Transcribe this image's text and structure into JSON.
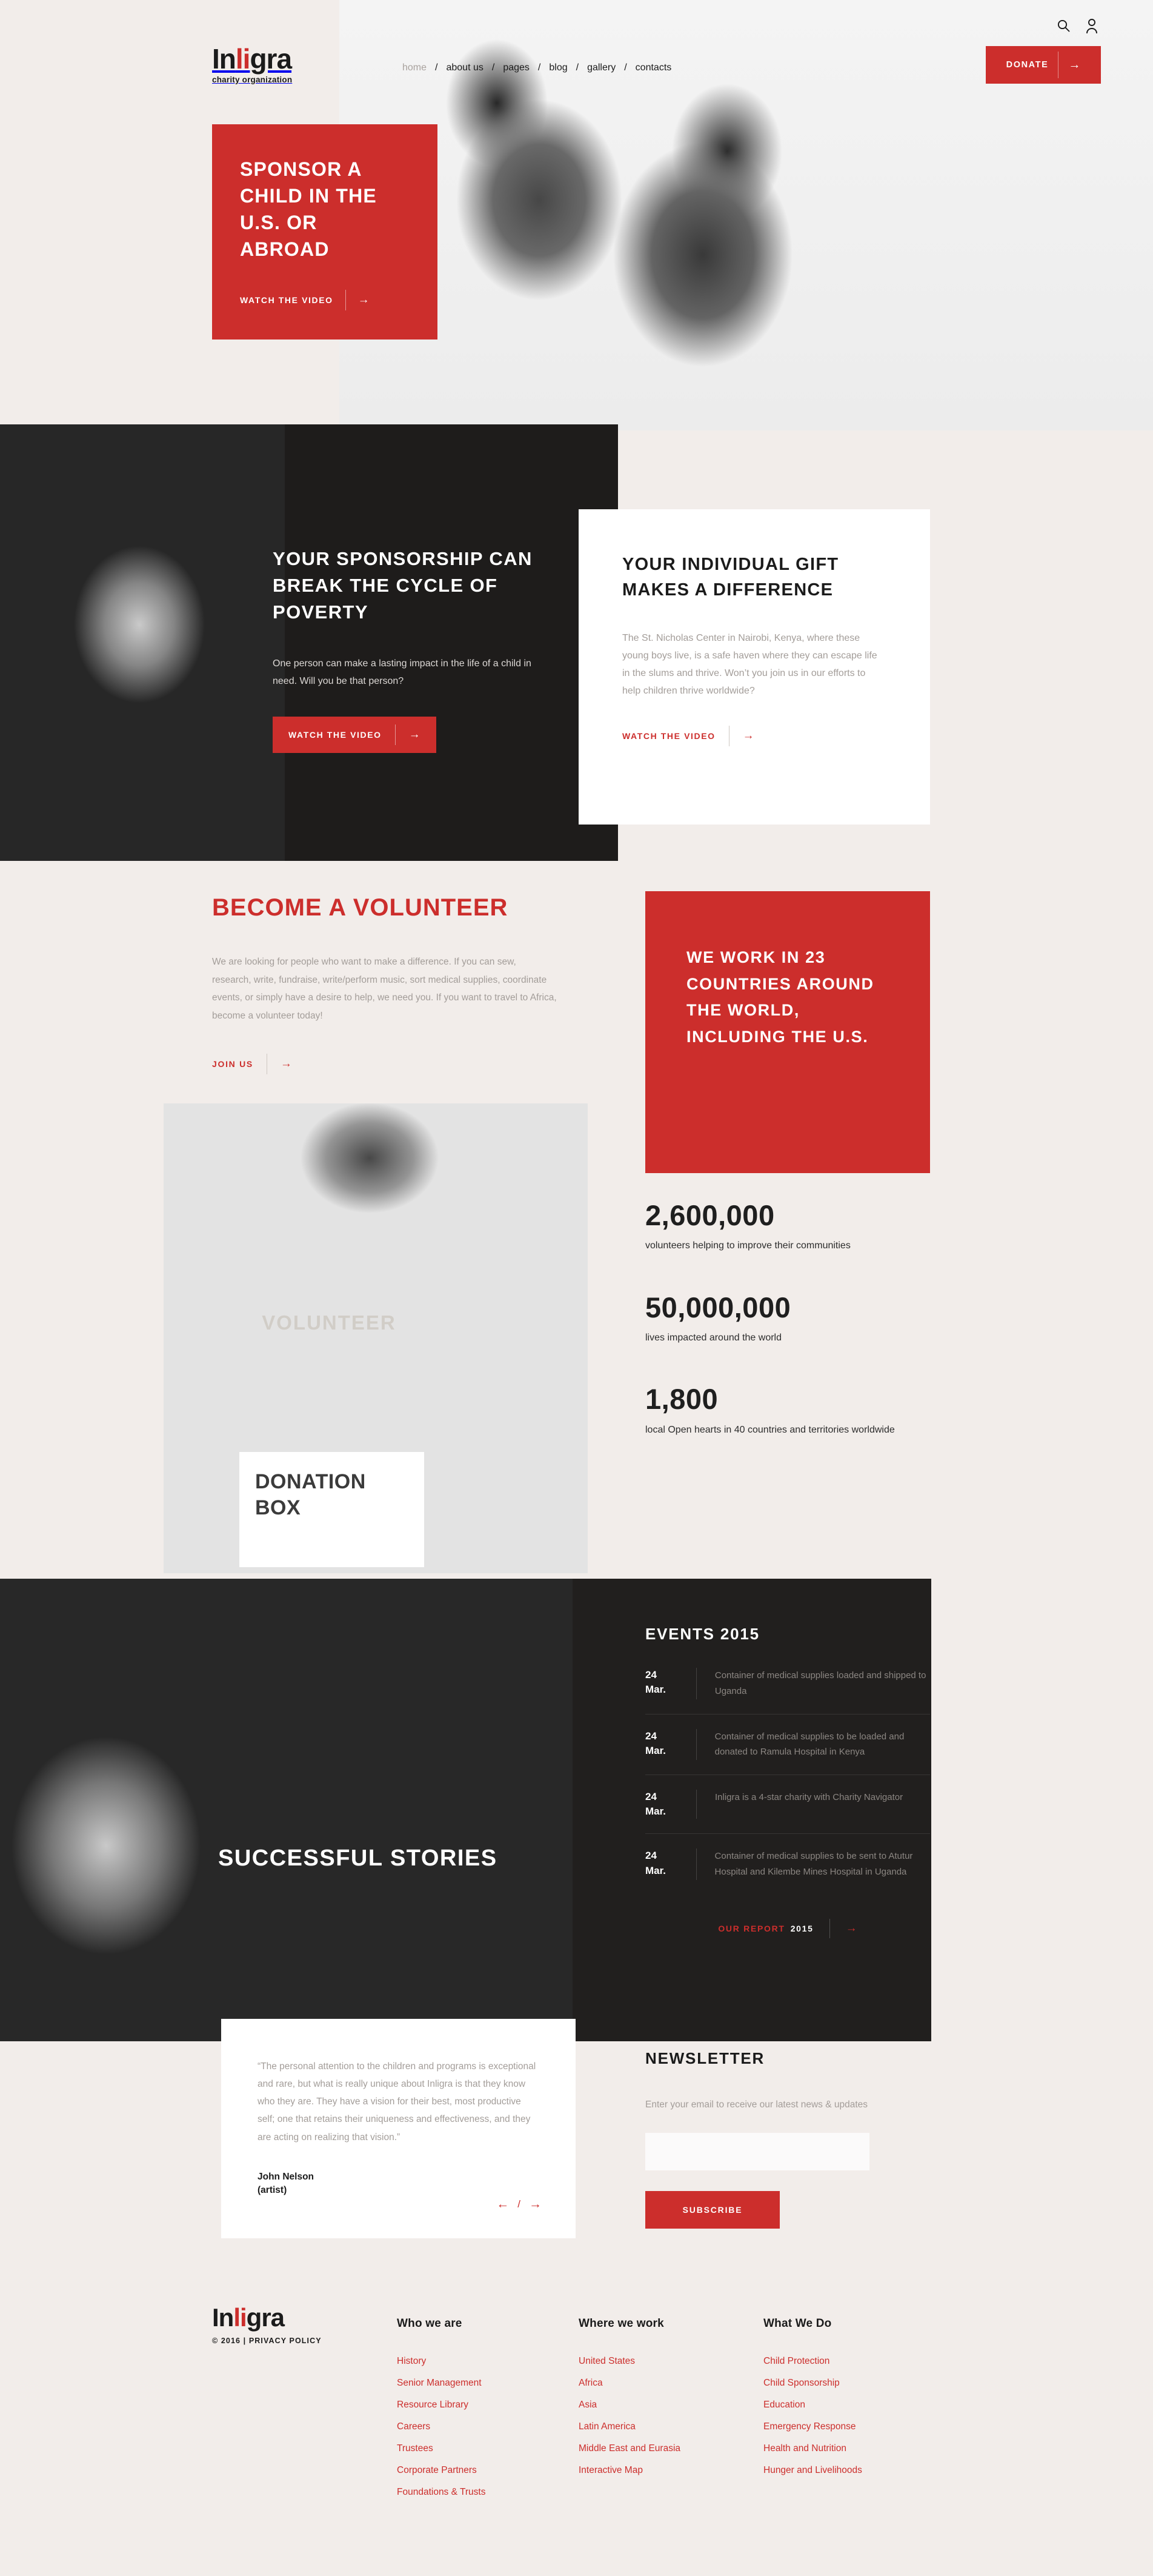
{
  "brand": {
    "name_part1": "In",
    "name_li": "li",
    "name_part2": "gra",
    "tagline": "charity organization"
  },
  "header": {
    "nav": [
      {
        "label": "home",
        "active": true
      },
      {
        "label": "about us",
        "active": false
      },
      {
        "label": "pages",
        "active": false
      },
      {
        "label": "blog",
        "active": false
      },
      {
        "label": "gallery",
        "active": false
      },
      {
        "label": "contacts",
        "active": false
      }
    ],
    "separator": "/",
    "donate_label": "DONATE",
    "arrow": "→",
    "search_icon": "search-icon",
    "account_icon": "user-icon"
  },
  "hero": {
    "title": "SPONSOR A CHILD IN THE U.S. OR ABROAD",
    "cta": "WATCH THE VIDEO",
    "arrow": "→"
  },
  "sponsorship": {
    "title": "YOUR SPONSORSHIP CAN BREAK THE CYCLE OF POVERTY",
    "body": "One person can make a lasting impact in the life of a child in need. Will you be that person?",
    "cta": "WATCH THE VIDEO",
    "arrow": "→"
  },
  "gift": {
    "title": "YOUR INDIVIDUAL GIFT MAKES A DIFFERENCE",
    "body": "The St. Nicholas Center in Nairobi, Kenya, where these young boys live, is a safe haven where they can escape life in the slums and thrive. Won’t you join us in our efforts to help children thrive worldwide?",
    "cta": "WATCH THE VIDEO",
    "arrow": "→"
  },
  "volunteer": {
    "title": "BECOME A VOLUNTEER",
    "body": "We are looking for people who want to make a difference. If you can sew, research, write, fundraise, write/perform music, sort medical supplies, coordinate events, or simply have a desire to help, we need you. If you want to travel to Africa, become a volunteer today!",
    "cta": "JOIN US",
    "arrow": "→",
    "photo_shirt_text": "VOLUNTEER",
    "photo_box_line1": "DONATION",
    "photo_box_line2": "BOX"
  },
  "countries": {
    "title": "WE WORK IN 23 COUNTRIES AROUND THE WORLD, INCLUDING THE U.S."
  },
  "stats": [
    {
      "number": "2,600,000",
      "caption": "volunteers helping to improve their communities"
    },
    {
      "number": "50,000,000",
      "caption": "lives impacted around the world"
    },
    {
      "number": "1,800",
      "caption": "local Open hearts in 40 countries and territories worldwide"
    }
  ],
  "stories": {
    "title": "SUCCESSFUL STORIES",
    "quote": "“The personal attention to the children and programs is exceptional and rare, but what is really unique about Inligra is that they know who they are. They have a vision for their best, most productive self; one that retains their uniqueness and effectiveness, and they are acting on realizing that vision.”",
    "author_name": "John Nelson",
    "author_role": "(artist)",
    "prev_arrow": "←",
    "slash": "/",
    "next_arrow": "→"
  },
  "events": {
    "title": "EVENTS 2015",
    "items": [
      {
        "day": "24",
        "month": "Mar.",
        "text": "Container of medical supplies loaded and shipped to Uganda"
      },
      {
        "day": "24",
        "month": "Mar.",
        "text": "Container of medical supplies to be loaded and donated to Ramula Hospital in Kenya"
      },
      {
        "day": "24",
        "month": "Mar.",
        "text": "Inligra is a 4-star charity with Charity Navigator"
      },
      {
        "day": "24",
        "month": "Mar.",
        "text": "Container of medical supplies to be sent to Atutur Hospital and Kilembe Mines Hospital in Uganda"
      }
    ],
    "report_label": "OUR REPORT",
    "report_year": "2015",
    "arrow": "→"
  },
  "newsletter": {
    "title": "NEWSLETTER",
    "description": "Enter your email to receive our latest news & updates",
    "input_value": "",
    "input_placeholder": "",
    "button_label": "SUBSCRIBE"
  },
  "footer": {
    "copyright": "© 2016",
    "copyright_sep": "|",
    "privacy": "PRIVACY POLICY",
    "columns": [
      {
        "title": "Who we are",
        "links": [
          "History",
          "Senior Management",
          "Resource Library",
          "Careers",
          "Trustees",
          "Corporate Partners",
          "Foundations & Trusts"
        ]
      },
      {
        "title": "Where we work",
        "links": [
          "United States",
          "Africa",
          "Asia",
          "Latin America",
          "Middle East and Eurasia",
          "Interactive Map"
        ]
      },
      {
        "title": "What We Do",
        "links": [
          "Child Protection",
          "Child Sponsorship",
          "Education",
          "Emergency Response",
          "Health and Nutrition",
          "Hunger and Livelihoods"
        ]
      }
    ]
  },
  "colors": {
    "accent": "#cc2e2c",
    "page_bg": "#f2edea",
    "dark_bg": "#1e1c1b",
    "muted_text": "#a39d99"
  }
}
